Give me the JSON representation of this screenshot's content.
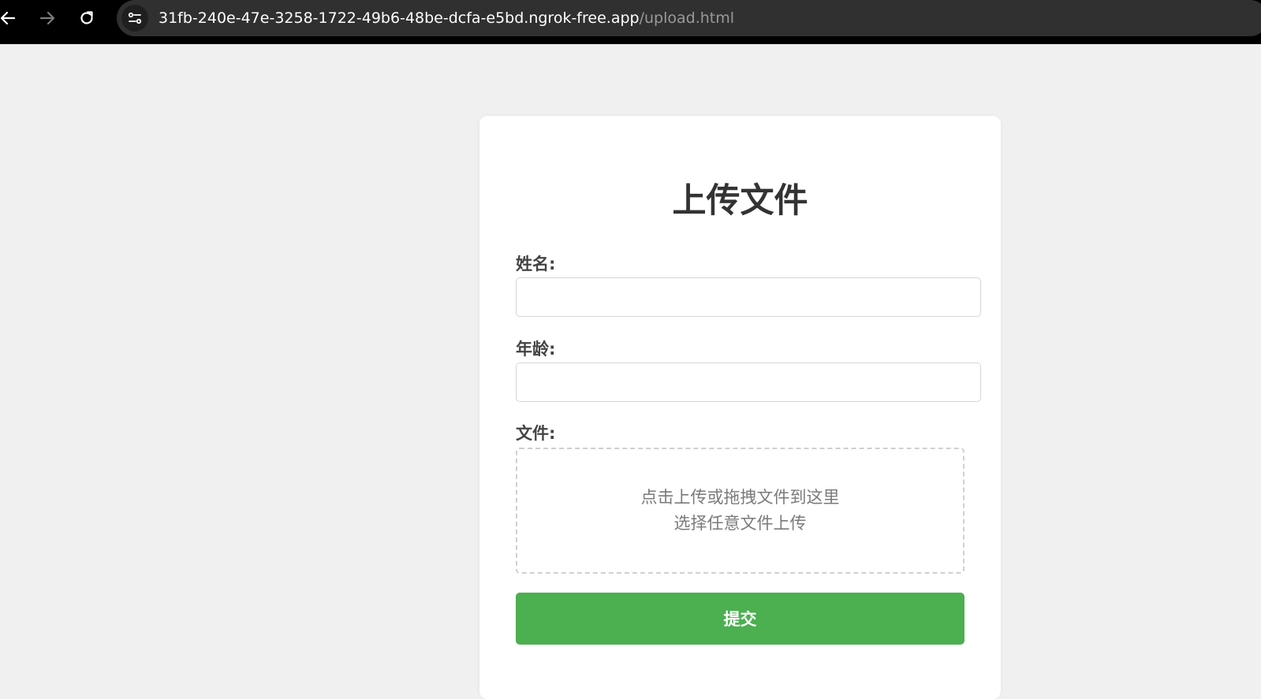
{
  "browser": {
    "url_host": "31fb-240e-47e-3258-1722-49b6-48be-dcfa-e5bd.ngrok-free.app",
    "url_path": "/upload.html",
    "icons": {
      "back": "arrow-left-icon",
      "forward": "arrow-right-icon",
      "reload": "reload-icon",
      "site_info": "site-settings-icon"
    }
  },
  "form": {
    "title": "上传文件",
    "name_label": "姓名:",
    "name_value": "",
    "age_label": "年龄:",
    "age_value": "",
    "file_label": "文件:",
    "drop_line1": "点击上传或拖拽文件到这里",
    "drop_line2": "选择任意文件上传",
    "submit_label": "提交"
  },
  "colors": {
    "page_background": "#f0f0f0",
    "card_background": "#ffffff",
    "submit_button": "#4caf50",
    "title_text": "#333333"
  }
}
